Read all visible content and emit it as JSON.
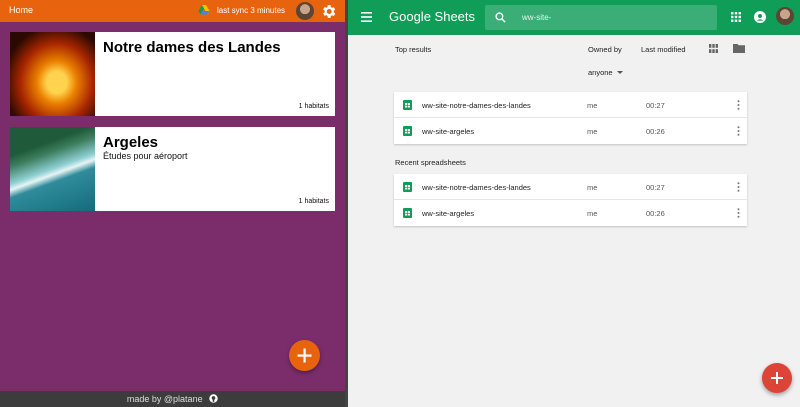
{
  "left_app": {
    "topbar": {
      "home_label": "Home",
      "sync_text": "last sync 3 minutes",
      "drive_icon": "google-drive-icon",
      "gear_icon": "gear-icon",
      "accent_color": "#e8630d"
    },
    "sites": [
      {
        "title": "Notre dames des Landes",
        "subtitle": "",
        "habitats": "1 habitats",
        "image": "fire-photo"
      },
      {
        "title": "Argeles",
        "subtitle": "Études pour aéroport",
        "habitats": "1 habitats",
        "image": "coast-aerial-photo"
      }
    ],
    "background_color": "#7b2d6b",
    "fab_icon": "plus-icon",
    "footer": {
      "text": "made by  @platane",
      "icon": "github-icon"
    }
  },
  "right_app": {
    "toolbar": {
      "menu_icon": "hamburger-menu-icon",
      "logo_google": "Google",
      "logo_sheets": "Sheets",
      "search_value": "ww-site-",
      "search_icon": "search-icon",
      "apps_icon": "apps-grid-icon",
      "account_icon": "account-circle-icon",
      "accent_color": "#0f9d58"
    },
    "filters": {
      "owned_by_label": "Owned by",
      "owned_by_value": "anyone",
      "last_modified_label": "Last modified",
      "grid_view_icon": "grid-view-icon",
      "folder_icon": "folder-icon"
    },
    "top_results_label": "Top results",
    "top_results": [
      {
        "name": "ww-site-notre-dames-des-landes",
        "owner": "me",
        "modified": "00:27"
      },
      {
        "name": "ww-site-argeles",
        "owner": "me",
        "modified": "00:26"
      }
    ],
    "recent_label": "Recent spreadsheets",
    "recent": [
      {
        "name": "ww-site-notre-dames-des-landes",
        "owner": "me",
        "modified": "00:27"
      },
      {
        "name": "ww-site-argeles",
        "owner": "me",
        "modified": "00:26"
      }
    ],
    "fab_color": "#db4437",
    "fab_icon": "plus-icon"
  }
}
